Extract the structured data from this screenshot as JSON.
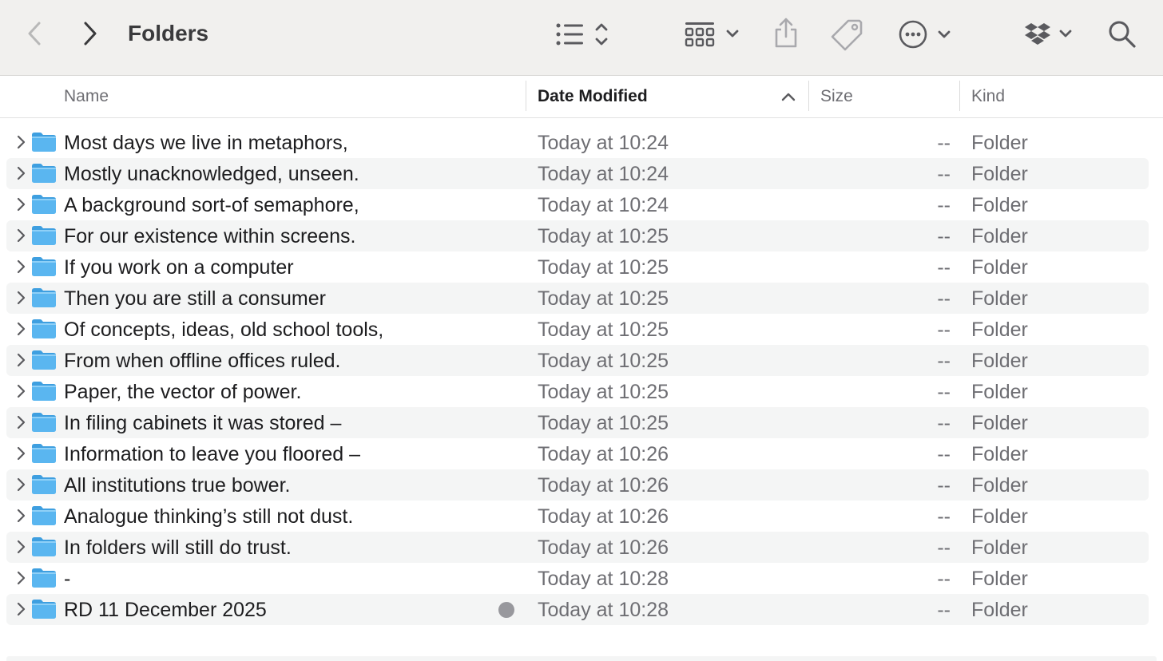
{
  "window": {
    "title": "Folders"
  },
  "toolbar": {
    "back_icon": "chevron-left-icon",
    "forward_icon": "chevron-right-icon",
    "view_options_icon": "list-view-icon",
    "group_icon": "grid-group-icon",
    "share_icon": "share-icon",
    "tag_icon": "tag-icon",
    "more_icon": "ellipsis-circle-icon",
    "dropbox_icon": "dropbox-icon",
    "search_icon": "search-icon"
  },
  "columns": {
    "name": "Name",
    "date_modified": "Date Modified",
    "size": "Size",
    "kind": "Kind",
    "sort_indicator": "sort-ascending-chevron-icon"
  },
  "rows": [
    {
      "name": "Most days we live in metaphors,",
      "date": "Today at 10:24",
      "size": "--",
      "kind": "Folder"
    },
    {
      "name": "Mostly unacknowledged, unseen.",
      "date": "Today at 10:24",
      "size": "--",
      "kind": "Folder"
    },
    {
      "name": "A background sort-of semaphore,",
      "date": "Today at 10:24",
      "size": "--",
      "kind": "Folder"
    },
    {
      "name": "For our existence within screens.",
      "date": "Today at 10:25",
      "size": "--",
      "kind": "Folder"
    },
    {
      "name": "If you work on a computer",
      "date": "Today at 10:25",
      "size": "--",
      "kind": "Folder"
    },
    {
      "name": "Then you are still a consumer",
      "date": "Today at 10:25",
      "size": "--",
      "kind": "Folder"
    },
    {
      "name": "Of concepts, ideas, old school tools,",
      "date": "Today at 10:25",
      "size": "--",
      "kind": "Folder"
    },
    {
      "name": "From when offline offices ruled.",
      "date": "Today at 10:25",
      "size": "--",
      "kind": "Folder"
    },
    {
      "name": "Paper, the vector of power.",
      "date": "Today at 10:25",
      "size": "--",
      "kind": "Folder"
    },
    {
      "name": "In filing cabinets it was stored –",
      "date": "Today at 10:25",
      "size": "--",
      "kind": "Folder"
    },
    {
      "name": "Information to leave you floored –",
      "date": "Today at 10:26",
      "size": "--",
      "kind": "Folder"
    },
    {
      "name": "All institutions true bower.",
      "date": "Today at 10:26",
      "size": "--",
      "kind": "Folder"
    },
    {
      "name": "Analogue thinking’s still not dust.",
      "date": "Today at 10:26",
      "size": "--",
      "kind": "Folder"
    },
    {
      "name": "In folders will still do trust.",
      "date": "Today at 10:26",
      "size": "--",
      "kind": "Folder"
    },
    {
      "name": "-",
      "date": "Today at 10:28",
      "size": "--",
      "kind": "Folder"
    },
    {
      "name": "RD 11 December 2025",
      "date": "Today at 10:28",
      "size": "--",
      "kind": "Folder",
      "tag_color": "#98989d"
    }
  ],
  "colors": {
    "folder_blue": "#5ab6f0",
    "folder_tab": "#3e9fe0",
    "toolbar_bg": "#f1f0ee",
    "row_alt": "#f4f5f5"
  }
}
